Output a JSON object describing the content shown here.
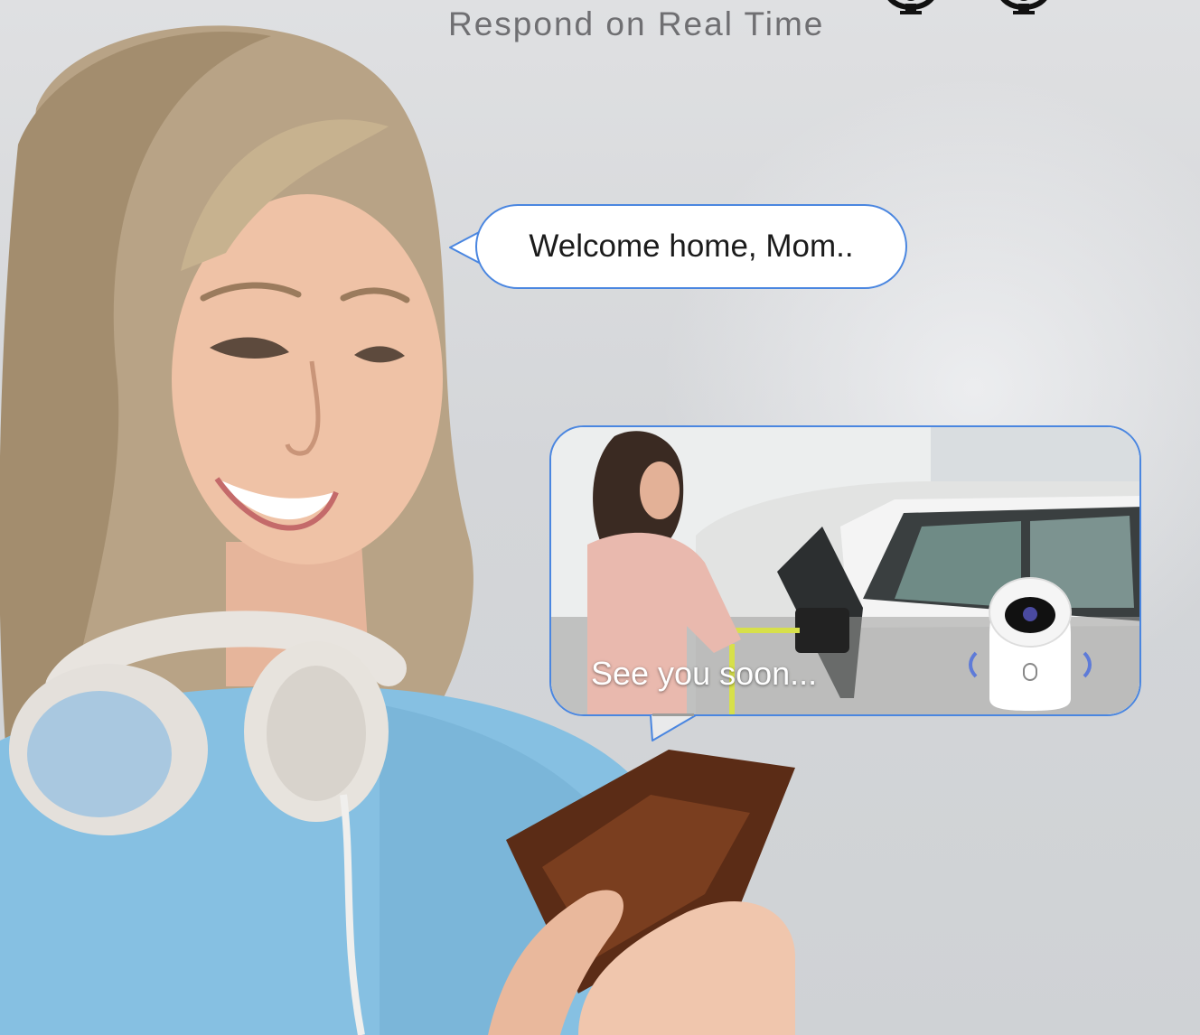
{
  "headline": "Respond on Real Time",
  "bubble_top": {
    "text": "Welcome home, Mom.."
  },
  "bubble_video": {
    "caption": "See you soon..."
  },
  "colors": {
    "bubble_border": "#4a86e0",
    "headline": "#6f6f72"
  },
  "icons": [
    "camera-mount-icon",
    "camera-mount-icon"
  ]
}
